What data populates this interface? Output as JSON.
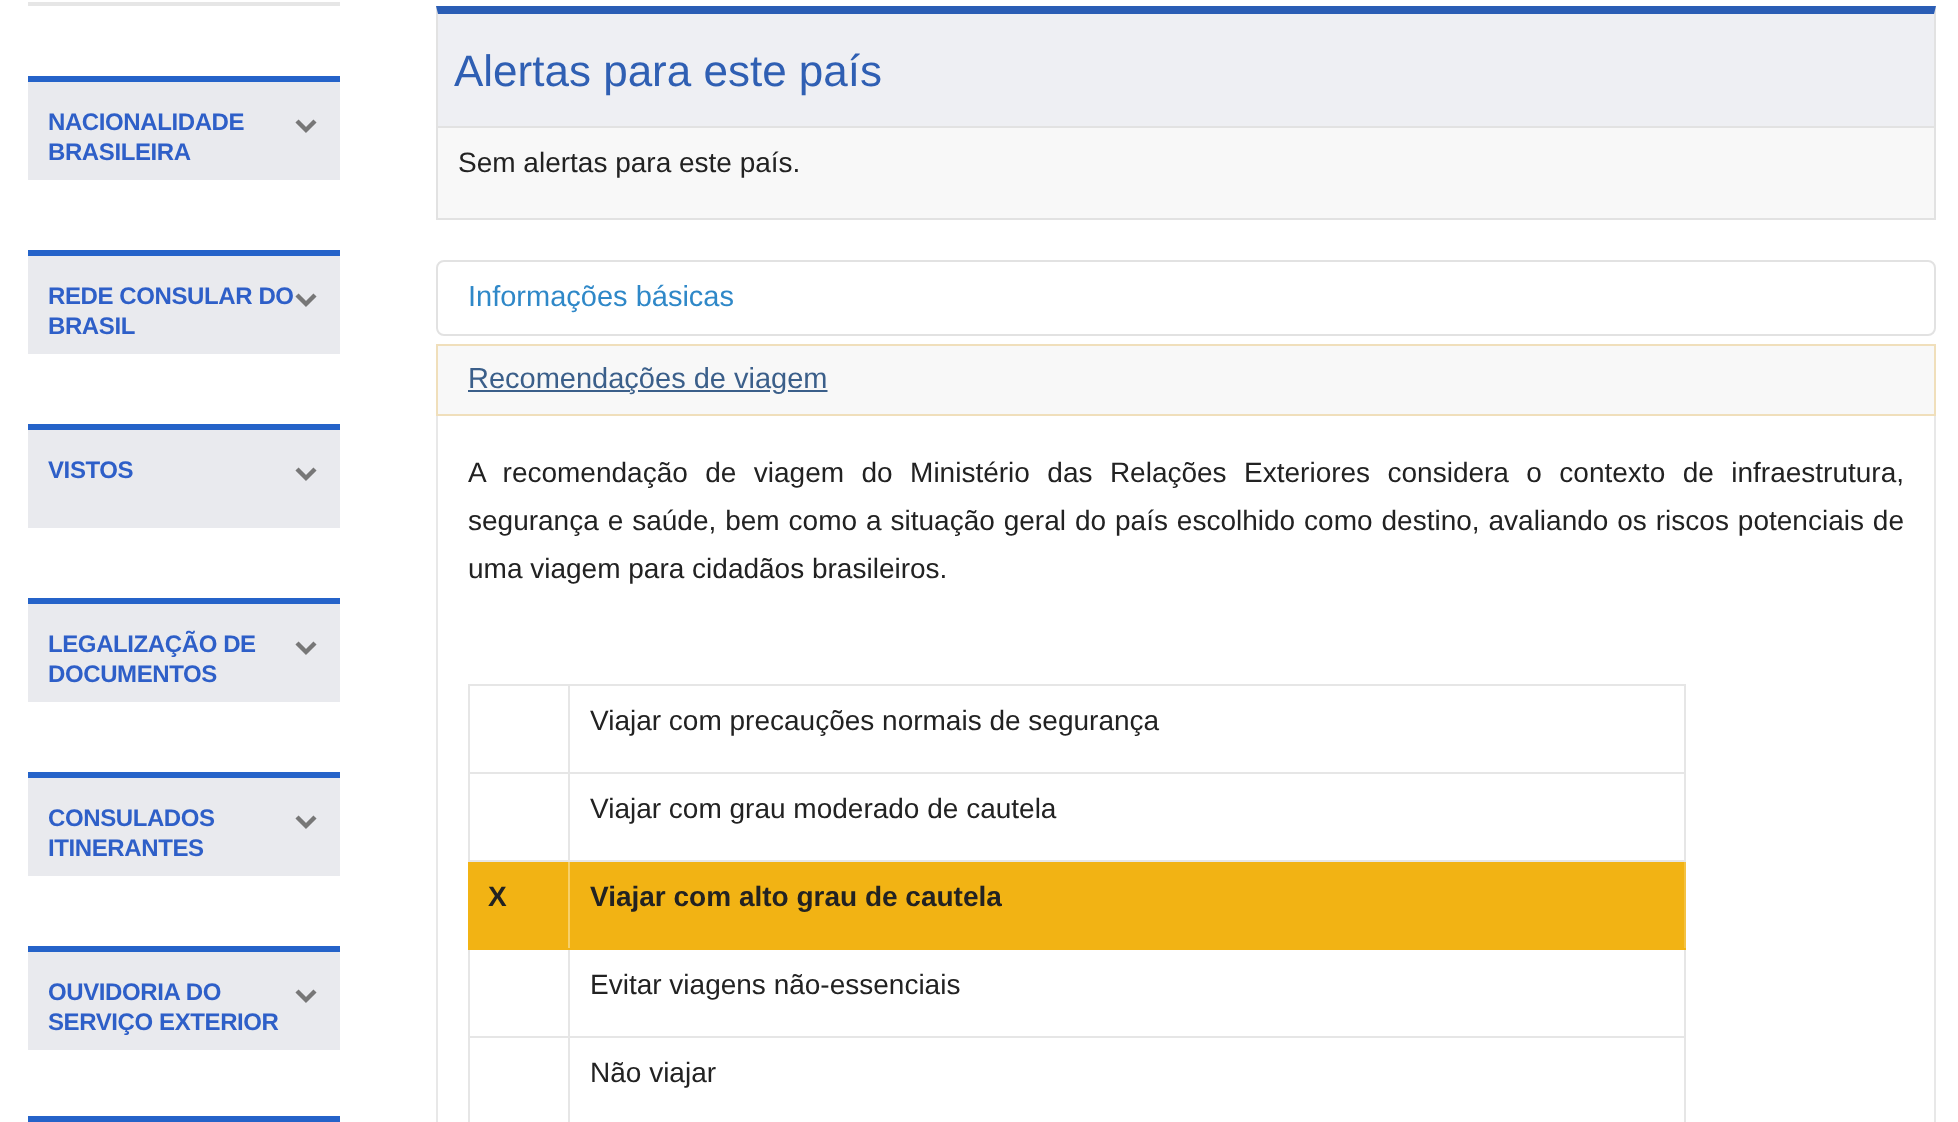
{
  "sidebar": {
    "items": [
      {
        "label": "NACIONALIDADE BRASILEIRA",
        "expanded": false
      },
      {
        "label": "REDE CONSULAR DO BRASIL",
        "expanded": false
      },
      {
        "label": "VISTOS",
        "expanded": false
      },
      {
        "label": "LEGALIZAÇÃO DE DOCUMENTOS",
        "expanded": false
      },
      {
        "label": "CONSULADOS ITINERANTES",
        "expanded": false
      },
      {
        "label": "OUVIDORIA DO SERVIÇO EXTERIOR",
        "expanded": false
      }
    ]
  },
  "alerts": {
    "title": "Alertas para este país",
    "message": "Sem alertas para este país."
  },
  "accordion": [
    {
      "label": "Informações básicas",
      "expanded": false
    },
    {
      "label": "Recomendações de viagem",
      "expanded": true
    }
  ],
  "recommendation": {
    "text": "A recomendação de viagem do Ministério das Relações Exteriores considera o contexto de infraestrutura, segurança e saúde, bem como a situação geral do país escolhido como destino, avaliando os riscos potenciais de uma viagem para cidadãos brasileiros.",
    "levels": [
      {
        "label": "Viajar com precauções normais de segurança",
        "selected": false
      },
      {
        "label": "Viajar com grau moderado de cautela",
        "selected": false
      },
      {
        "mark": "X",
        "label": "Viajar com alto grau de cautela",
        "selected": true
      },
      {
        "label": "Evitar viagens não-essenciais",
        "selected": false
      },
      {
        "label": "Não viajar",
        "selected": false
      }
    ]
  }
}
